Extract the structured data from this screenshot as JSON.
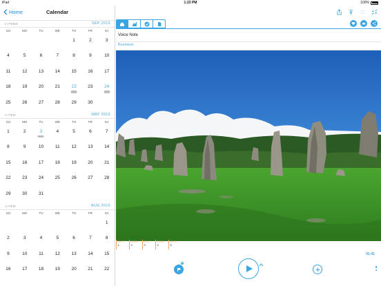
{
  "status": {
    "device": "iPad",
    "time": "1:23 PM",
    "battery": "100%"
  },
  "nav": {
    "back_label": "Home",
    "title": "Calendar"
  },
  "weekday_labels": [
    "SU",
    "MO",
    "TU",
    "WE",
    "TH",
    "FR",
    "SA"
  ],
  "months": [
    {
      "items_label": "2 ITEMS",
      "name": "SEP 2016",
      "weeks": [
        [
          "",
          "",
          "",
          "",
          "1",
          "2",
          "3"
        ],
        [
          "4",
          "5",
          "6",
          "7",
          "8",
          "9",
          "10"
        ],
        [
          "11",
          "12",
          "13",
          "14",
          "15",
          "16",
          "17"
        ],
        [
          "18",
          "19",
          "20",
          "21",
          "22",
          "23",
          "24"
        ],
        [
          "25",
          "26",
          "27",
          "28",
          "29",
          "30",
          ""
        ]
      ],
      "marked": [
        "22",
        "24"
      ]
    },
    {
      "items_label": "1 ITEM",
      "name": "MAY 2016",
      "weeks": [
        [
          "1",
          "2",
          "3",
          "4",
          "5",
          "6",
          "7"
        ],
        [
          "8",
          "9",
          "10",
          "11",
          "12",
          "13",
          "14"
        ],
        [
          "15",
          "16",
          "17",
          "18",
          "19",
          "20",
          "21"
        ],
        [
          "22",
          "23",
          "24",
          "25",
          "26",
          "27",
          "28"
        ],
        [
          "29",
          "30",
          "31",
          "",
          "",
          "",
          ""
        ]
      ],
      "marked": [
        "3"
      ]
    },
    {
      "items_label": "1 ITEM",
      "name": "AUG 2016",
      "weeks": [
        [
          "",
          "",
          "",
          "",
          "",
          "",
          "1"
        ],
        [
          "2",
          "3",
          "4",
          "5",
          "6",
          "7",
          "8"
        ],
        [
          "9",
          "10",
          "11",
          "12",
          "13",
          "14",
          "15"
        ],
        [
          "16",
          "17",
          "18",
          "19",
          "20",
          "21",
          "22"
        ]
      ],
      "marked": []
    }
  ],
  "note": {
    "title": "Voice Note",
    "category": "Business"
  },
  "tabs": [
    {
      "icon": "home-icon",
      "active": true
    },
    {
      "icon": "chart-icon",
      "active": false
    },
    {
      "icon": "check-icon",
      "active": false
    },
    {
      "icon": "document-icon",
      "active": false
    }
  ],
  "timeline": [
    {
      "time": "01:17",
      "index": "1"
    },
    {
      "time": "02:08",
      "index": "2"
    },
    {
      "time": "01:17",
      "index": "3"
    },
    {
      "time": "01:08",
      "index": "4"
    },
    {
      "time": "01:11",
      "index": "5"
    }
  ],
  "duration": "01:41",
  "colors": {
    "accent": "#3ba5e3",
    "timeline": "#f2a35c",
    "sky": "#2f6fc4",
    "grass": "#3f9a2a"
  }
}
